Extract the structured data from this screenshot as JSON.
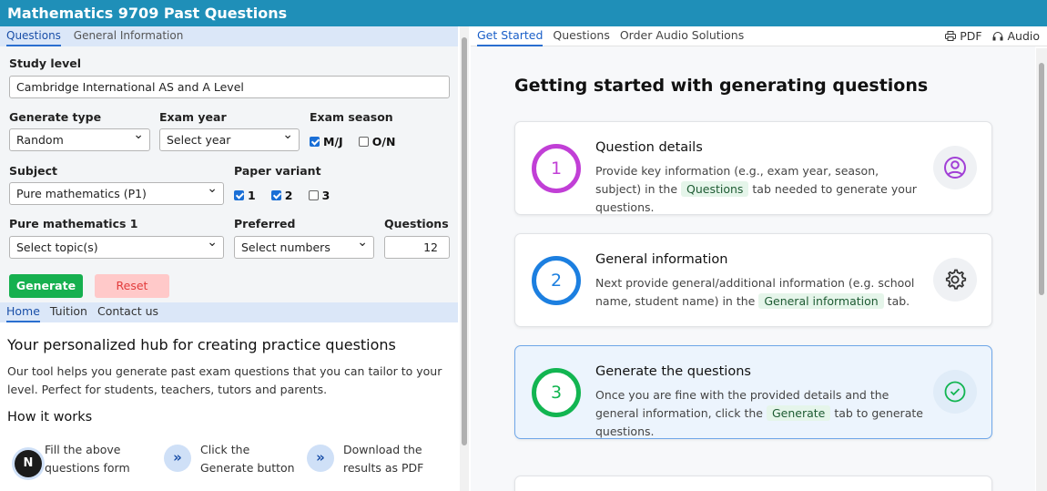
{
  "app": {
    "title": "Mathematics 9709 Past Questions"
  },
  "left_tabs": [
    {
      "label": "Questions"
    },
    {
      "label": "General Information"
    }
  ],
  "form": {
    "study_level": {
      "label": "Study level",
      "value": "Cambridge International AS and A Level"
    },
    "generate_type": {
      "label": "Generate type",
      "value": "Random"
    },
    "exam_year": {
      "label": "Exam year",
      "value": "Select year"
    },
    "exam_season": {
      "label": "Exam season",
      "options": [
        {
          "label": "M/J",
          "checked": true
        },
        {
          "label": "O/N",
          "checked": false
        }
      ]
    },
    "subject": {
      "label": "Subject",
      "value": "Pure mathematics (P1)"
    },
    "paper_variant": {
      "label": "Paper variant",
      "options": [
        {
          "label": "1",
          "checked": true
        },
        {
          "label": "2",
          "checked": true
        },
        {
          "label": "3",
          "checked": false
        }
      ]
    },
    "topic": {
      "label": "Pure mathematics 1",
      "value": "Select topic(s)"
    },
    "preferred": {
      "label": "Preferred",
      "value": "Select numbers"
    },
    "questions": {
      "label": "Questions",
      "value": "12"
    },
    "generate_label": "Generate",
    "reset_label": "Reset"
  },
  "home_tabs": [
    {
      "label": "Home"
    },
    {
      "label": "Tuition"
    },
    {
      "label": "Contact us"
    }
  ],
  "hub": {
    "title": "Your personalized hub for creating practice questions",
    "description": "Our tool helps you generate past exam questions that you can tailor to your level. Perfect for students, teachers, tutors and parents.",
    "how_title": "How it works",
    "steps": [
      "Fill the above questions form",
      "Click the Generate button",
      "Download the results as PDF"
    ],
    "badge": "N"
  },
  "right_tabs": [
    {
      "label": "Get Started"
    },
    {
      "label": "Questions"
    },
    {
      "label": "Order Audio Solutions"
    }
  ],
  "tools": {
    "pdf": "PDF",
    "audio": "Audio"
  },
  "main": {
    "title": "Getting started with generating questions",
    "cards": [
      {
        "num": "1",
        "title": "Question details",
        "pre": "Provide key information (e.g., exam year, season, subject) in the ",
        "hl": "Questions",
        "post": " tab needed to generate your questions.",
        "icon": "user-icon"
      },
      {
        "num": "2",
        "title": "General information",
        "pre": "Next provide general/additional information (e.g. school name, student name) in the ",
        "hl": "General information",
        "post": " tab.",
        "icon": "gear-icon"
      },
      {
        "num": "3",
        "title": "Generate the questions",
        "pre": "Once you are fine with the provided details and the general information, click the ",
        "hl": "Generate",
        "post": " tab to generate questions.",
        "icon": "check-circle-icon"
      }
    ]
  },
  "colors": {
    "header": "#1f8fb8",
    "generate": "#16b04f",
    "reset_bg": "#ffc9c9",
    "ring1": "#c13fd6",
    "ring2": "#1c7fe0",
    "ring3": "#12b551"
  }
}
